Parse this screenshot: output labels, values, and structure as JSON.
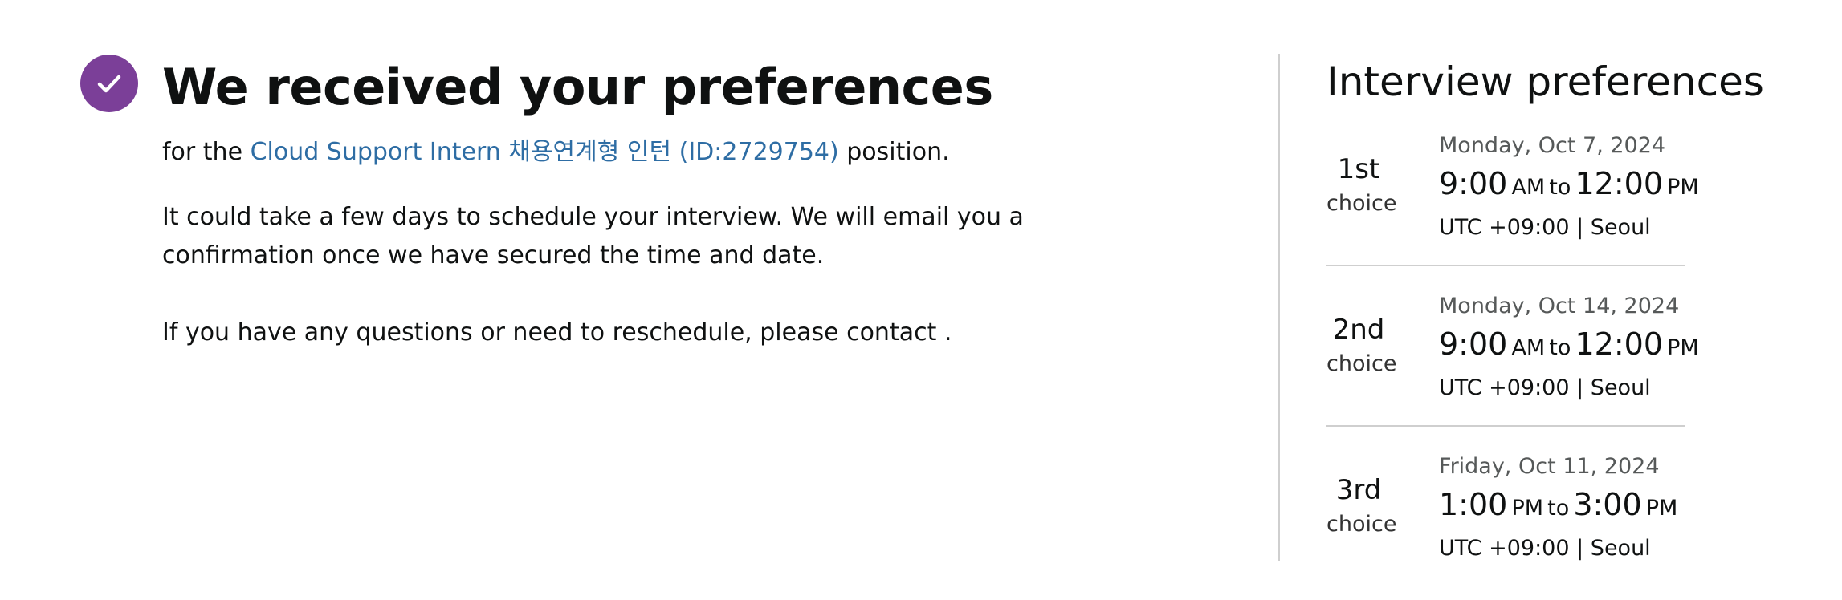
{
  "confirmation": {
    "title": "We received your preferences",
    "position_prefix": "for the ",
    "position_link": "Cloud Support Intern 채용연계형 인턴 (ID:2729754)",
    "position_suffix": " position.",
    "scheduling_note": "It could take a few days to schedule your interview. We will email you a confirmation once we have secured the time and date.",
    "contact_note": "If you have any questions or need to reschedule, please contact ."
  },
  "preferences": {
    "title": "Interview preferences",
    "choices": [
      {
        "rank": "1st",
        "rank_word": "choice",
        "date": "Monday, Oct 7, 2024",
        "start_time": "9:00",
        "start_period": "AM",
        "connector": "to",
        "end_time": "12:00",
        "end_period": "PM",
        "timezone": "UTC +09:00 | Seoul"
      },
      {
        "rank": "2nd",
        "rank_word": "choice",
        "date": "Monday, Oct 14, 2024",
        "start_time": "9:00",
        "start_period": "AM",
        "connector": "to",
        "end_time": "12:00",
        "end_period": "PM",
        "timezone": "UTC +09:00 | Seoul"
      },
      {
        "rank": "3rd",
        "rank_word": "choice",
        "date": "Friday, Oct 11, 2024",
        "start_time": "1:00",
        "start_period": "PM",
        "connector": "to",
        "end_time": "3:00",
        "end_period": "PM",
        "timezone": "UTC +09:00 | Seoul"
      }
    ]
  },
  "icons": {
    "success": "check-icon"
  },
  "colors": {
    "success_circle": "#7b3f98",
    "link": "#2e6da4",
    "text": "#0f1111",
    "muted": "#565959",
    "divider": "#cfcfcf"
  }
}
